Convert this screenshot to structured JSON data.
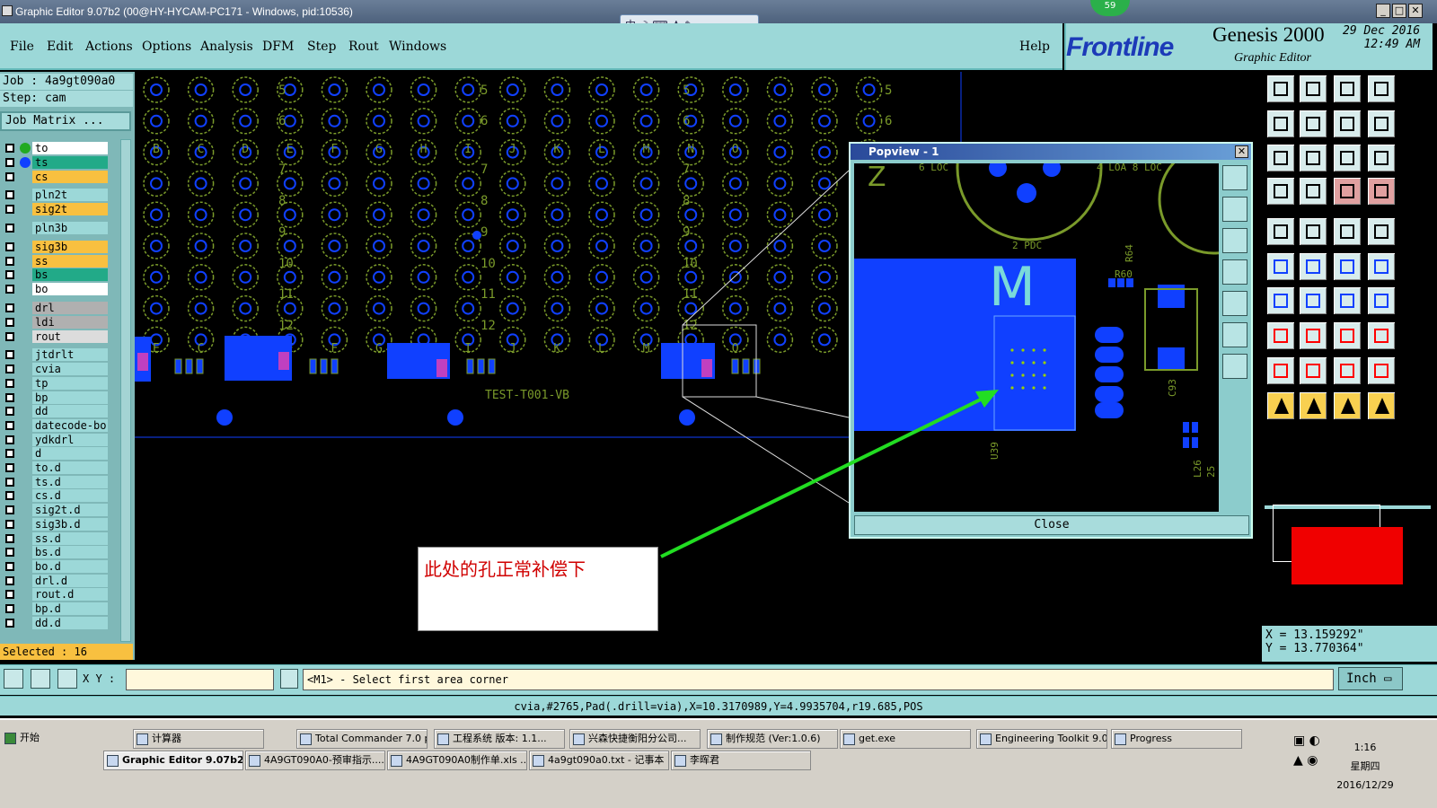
{
  "window": {
    "title": "Graphic Editor 9.07b2 (00@HY-HYCAM-PC171 - Windows, pid:10536)",
    "min": "_",
    "max": "□",
    "close": "✕"
  },
  "badge": "59",
  "ime": "中",
  "menu": [
    "File",
    "Edit",
    "Actions",
    "Options",
    "Analysis",
    "DFM",
    "Step",
    "Rout",
    "Windows"
  ],
  "help": "Help",
  "brand": {
    "logo": "Frontline",
    "product": "Genesis 2000",
    "subtitle": "Graphic Editor",
    "date": "29 Dec 2016",
    "time": "12:49 AM"
  },
  "job": {
    "job_line": "Job : 4a9gt090a0",
    "step_line": "Step: cam",
    "matrix_button": "Job Matrix ..."
  },
  "layers": [
    {
      "name": "to",
      "color": "#ffffff",
      "dot": "#22aa22"
    },
    {
      "name": "ts",
      "color": "#22aa88",
      "dot": "#1040ff"
    },
    {
      "name": "cs",
      "color": "#f8c040",
      "dot": ""
    },
    {
      "name": "pln2t",
      "color": "#9cd8d8",
      "dot": ""
    },
    {
      "name": "sig2t",
      "color": "#f8c040",
      "dot": ""
    },
    {
      "name": "pln3b",
      "color": "#9cd8d8",
      "dot": ""
    },
    {
      "name": "sig3b",
      "color": "#f8c040",
      "dot": ""
    },
    {
      "name": "ss",
      "color": "#f8c040",
      "dot": ""
    },
    {
      "name": "bs",
      "color": "#22aa88",
      "dot": ""
    },
    {
      "name": "bo",
      "color": "#ffffff",
      "dot": ""
    },
    {
      "name": "drl",
      "color": "#b0b0b0",
      "dot": ""
    },
    {
      "name": "ldi",
      "color": "#b0b0b0",
      "dot": ""
    },
    {
      "name": "rout",
      "color": "#dcdcdc",
      "dot": ""
    },
    {
      "name": "jtdrlt",
      "color": "#9cd8d8",
      "dot": ""
    },
    {
      "name": "cvia",
      "color": "#9cd8d8",
      "dot": ""
    },
    {
      "name": "tp",
      "color": "#9cd8d8",
      "dot": ""
    },
    {
      "name": "bp",
      "color": "#9cd8d8",
      "dot": ""
    },
    {
      "name": "dd",
      "color": "#9cd8d8",
      "dot": ""
    },
    {
      "name": "datecode-bo",
      "color": "#9cd8d8",
      "dot": ""
    },
    {
      "name": "ydkdrl",
      "color": "#9cd8d8",
      "dot": ""
    },
    {
      "name": "d",
      "color": "#9cd8d8",
      "dot": ""
    },
    {
      "name": "to.d",
      "color": "#9cd8d8",
      "dot": ""
    },
    {
      "name": "ts.d",
      "color": "#9cd8d8",
      "dot": ""
    },
    {
      "name": "cs.d",
      "color": "#9cd8d8",
      "dot": ""
    },
    {
      "name": "sig2t.d",
      "color": "#9cd8d8",
      "dot": ""
    },
    {
      "name": "sig3b.d",
      "color": "#9cd8d8",
      "dot": ""
    },
    {
      "name": "ss.d",
      "color": "#9cd8d8",
      "dot": ""
    },
    {
      "name": "bs.d",
      "color": "#9cd8d8",
      "dot": ""
    },
    {
      "name": "bo.d",
      "color": "#9cd8d8",
      "dot": ""
    },
    {
      "name": "drl.d",
      "color": "#9cd8d8",
      "dot": ""
    },
    {
      "name": "rout.d",
      "color": "#9cd8d8",
      "dot": ""
    },
    {
      "name": "bp.d",
      "color": "#9cd8d8",
      "dot": ""
    },
    {
      "name": "dd.d",
      "color": "#9cd8d8",
      "dot": ""
    }
  ],
  "selected": "Selected : 16",
  "canvas": {
    "row_numbers": [
      "5",
      "6",
      "7",
      "8",
      "9",
      "10",
      "11",
      "12"
    ],
    "col_letters": [
      "B",
      "C",
      "D",
      "E",
      "F",
      "G",
      "H",
      "I",
      "J",
      "K",
      "L",
      "M",
      "N",
      "O"
    ],
    "board_text": "TEST-T001-VB",
    "bottom_letters": [
      "E",
      "C",
      "D",
      "E",
      "F",
      "G",
      "H",
      "I",
      "J",
      "K",
      "L",
      "M",
      "N",
      "O"
    ]
  },
  "popview": {
    "title": "Popview - 1",
    "close": "Close",
    "close_x": "✕",
    "labels": {
      "loc1": "6 LOC",
      "loc2": "4 LOA 8 LOC",
      "pdc": "2 PDC",
      "m": "M",
      "r64": "R64",
      "r60": "R60",
      "c93": "C93",
      "u39": "U39",
      "l26": "L26",
      "l25": "25",
      "z": "Z"
    }
  },
  "annotation": "此处的孔正常补偿下",
  "coords": {
    "x": "X = 13.159292\"",
    "y": "Y = 13.770364\""
  },
  "cmd": {
    "xy_label": "X Y :",
    "xy_value": "",
    "prompt": "<M1> - Select first area corner",
    "units": "Inch"
  },
  "status": "cvia,#2765,Pad(.drill=via),X=10.3170989,Y=4.9935704,r19.685,POS",
  "taskbar": {
    "start": "开始",
    "row1": [
      "计算器",
      "Total Commander 7.0 p...",
      "工程系统  版本: 1.1...",
      "兴森快捷衡阳分公司...",
      "制作规范 (Ver:1.0.6)",
      "get.exe",
      "Engineering Toolkit 9.0...",
      "Progress"
    ],
    "row2": [
      "Graphic Editor 9.07b2 ...",
      "4A9GT090A0-预审指示....",
      "4A9GT090A0制作单.xls ...",
      "4a9gt090a0.txt - 记事本",
      "李晖君"
    ],
    "clock": "1:16",
    "weekday": "星期四",
    "date": "2016/12/29"
  },
  "colors": {
    "panel": "#9cd8d8",
    "board_green": "#7a9a2a",
    "copper_blue": "#1040ff",
    "annotation_red": "#d00000",
    "arrow_green": "#22dd22"
  }
}
